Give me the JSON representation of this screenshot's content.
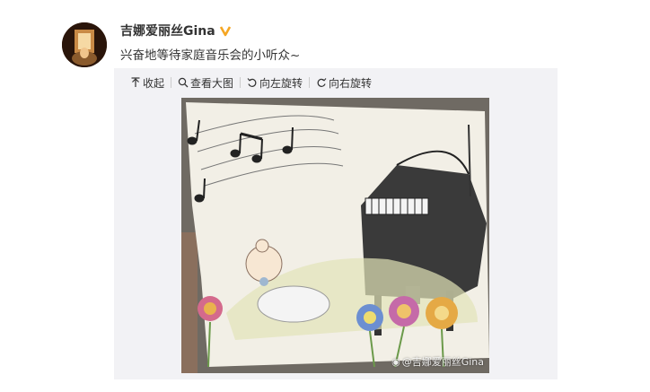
{
  "post": {
    "username": "吉娜爱丽丝Gina",
    "text": "兴奋地等待家庭音乐会的小听众~",
    "verified_color": "#f5a623"
  },
  "toolbar": {
    "collapse": "收起",
    "view_large": "查看大图",
    "rotate_left": "向左旋转",
    "rotate_right": "向右旋转"
  },
  "image": {
    "watermark": "@吉娜爱丽丝Gina"
  },
  "colors": {
    "accent": "#333333",
    "media_bg": "#f2f2f5"
  }
}
